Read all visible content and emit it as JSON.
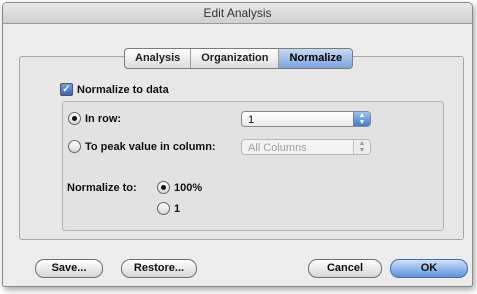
{
  "window": {
    "title": "Edit Analysis"
  },
  "tabs": [
    {
      "label": "Analysis",
      "active": false
    },
    {
      "label": "Organization",
      "active": false
    },
    {
      "label": "Normalize",
      "active": true
    }
  ],
  "normalize_checkbox": {
    "label": "Normalize to data",
    "checked": true
  },
  "row_option": {
    "label": "In row:",
    "selected": true,
    "popup_value": "1"
  },
  "peak_option": {
    "label": "To peak value in column:",
    "selected": false,
    "popup_value": "All Columns",
    "popup_enabled": false
  },
  "normalize_to": {
    "label": "Normalize to:",
    "options": [
      {
        "label": "100%",
        "selected": true
      },
      {
        "label": "1",
        "selected": false
      }
    ]
  },
  "buttons": {
    "save": "Save...",
    "restore": "Restore...",
    "cancel": "Cancel",
    "ok": "OK"
  },
  "colors": {
    "accent": "#5b93dd",
    "window_bg": "#ececec"
  }
}
